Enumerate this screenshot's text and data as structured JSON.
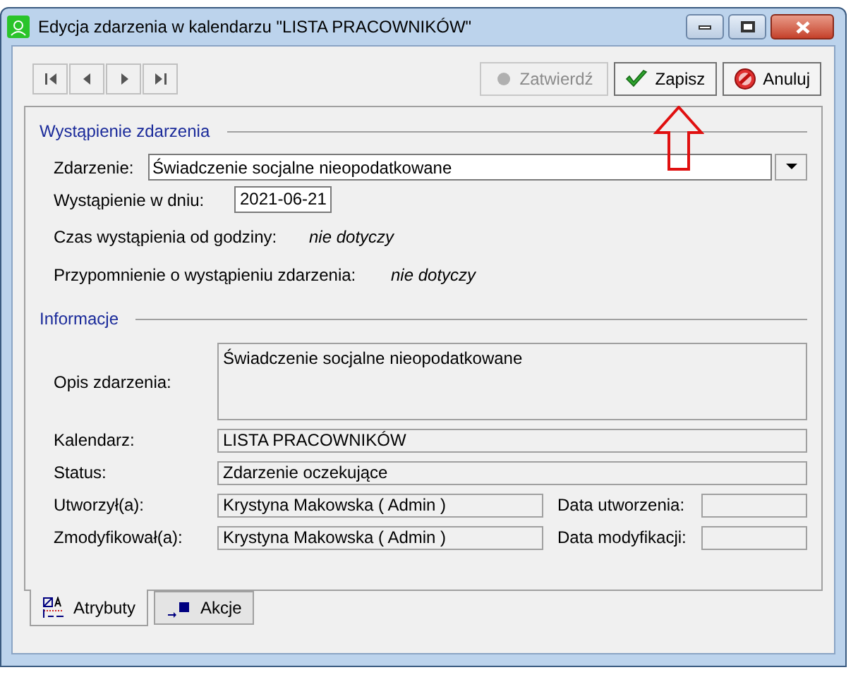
{
  "window": {
    "title": "Edycja zdarzenia w kalendarzu \"LISTA PRACOWNIKÓW\""
  },
  "toolbar": {
    "nav_buttons": [
      {
        "kind": "first"
      },
      {
        "kind": "prev"
      },
      {
        "kind": "next"
      },
      {
        "kind": "last"
      }
    ],
    "buttons": [
      {
        "kind": "confirm",
        "label": "Zatwierdź",
        "disabled": true
      },
      {
        "kind": "save",
        "label": "Zapisz",
        "disabled": false
      },
      {
        "kind": "cancel",
        "label": "Anuluj",
        "disabled": false
      }
    ]
  },
  "occurrence": {
    "title": "Wystąpienie zdarzenia",
    "event": {
      "label": "Zdarzenie:",
      "value": "Świadczenie socjalne nieopodatkowane"
    },
    "date": {
      "label": "Wystąpienie w dniu:",
      "value": "2021-06-21"
    },
    "time": {
      "label": "Czas wystąpienia od godziny:",
      "value": "nie dotyczy"
    },
    "reminder": {
      "label": "Przypomnienie o wystąpieniu zdarzenia:",
      "value": "nie dotyczy"
    }
  },
  "info": {
    "title": "Informacje",
    "description": {
      "label": "Opis zdarzenia:",
      "value": "Świadczenie socjalne nieopodatkowane"
    },
    "calendar": {
      "label": "Kalendarz:",
      "value": "LISTA PRACOWNIKÓW"
    },
    "status": {
      "label": "Status:",
      "value": "Zdarzenie oczekujące"
    },
    "created_by": {
      "label": "Utworzył(a):",
      "value": "Krystyna Makowska ( Admin )",
      "date_label": "Data utworzenia:"
    },
    "modified_by": {
      "label": "Zmodyfikował(a):",
      "value": "Krystyna Makowska ( Admin )",
      "date_label": "Data modyfikacji:"
    }
  },
  "tabs": [
    {
      "kind": "attributes",
      "label": "Atrybuty",
      "selected": true
    },
    {
      "kind": "actions",
      "label": "Akcje",
      "selected": false
    }
  ]
}
